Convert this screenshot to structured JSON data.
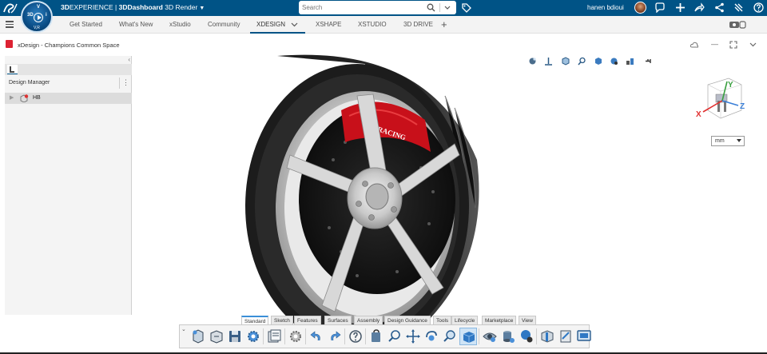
{
  "topbar": {
    "brand_bold": "3D",
    "brand_rest": "EXPERIENCE | ",
    "brand_dash": "3DDashboard",
    "brand_app": " 3D Render",
    "compass_q1": "3D",
    "compass_q2": "V",
    "compass_q3": "i",
    "compass_version": "V,R",
    "search_placeholder": "Search",
    "user_name": "hanen bdioui"
  },
  "tabs": [
    {
      "label": "Get Started"
    },
    {
      "label": "What's New"
    },
    {
      "label": "xStudio"
    },
    {
      "label": "Community"
    },
    {
      "label": "XDESIGN"
    },
    {
      "label": "XSHAPE"
    },
    {
      "label": "XSTUDIO"
    },
    {
      "label": "3D DRIVE"
    }
  ],
  "document": {
    "title": "xDesign - Champions Common Space"
  },
  "left_panel": {
    "section_label": "Design Manager",
    "tree": [
      {
        "label": "HB"
      }
    ]
  },
  "viewport": {
    "hub_text": "RACING",
    "units_value": "mm",
    "axis_x": "X",
    "axis_y": "Y",
    "axis_z": "Z"
  },
  "command_tabs": [
    {
      "label": "Standard"
    },
    {
      "label": "Sketch"
    },
    {
      "label": "Features"
    },
    {
      "label": "Surfaces"
    },
    {
      "label": "Assembly"
    },
    {
      "label": "Design Guidance"
    },
    {
      "label": "Tools"
    },
    {
      "label": "Lifecycle"
    },
    {
      "label": "Marketplace"
    },
    {
      "label": "View"
    }
  ],
  "colors": {
    "brand_blue": "#005386",
    "caliper_red": "#c8101a",
    "accent_blue": "#3a8fd8"
  }
}
